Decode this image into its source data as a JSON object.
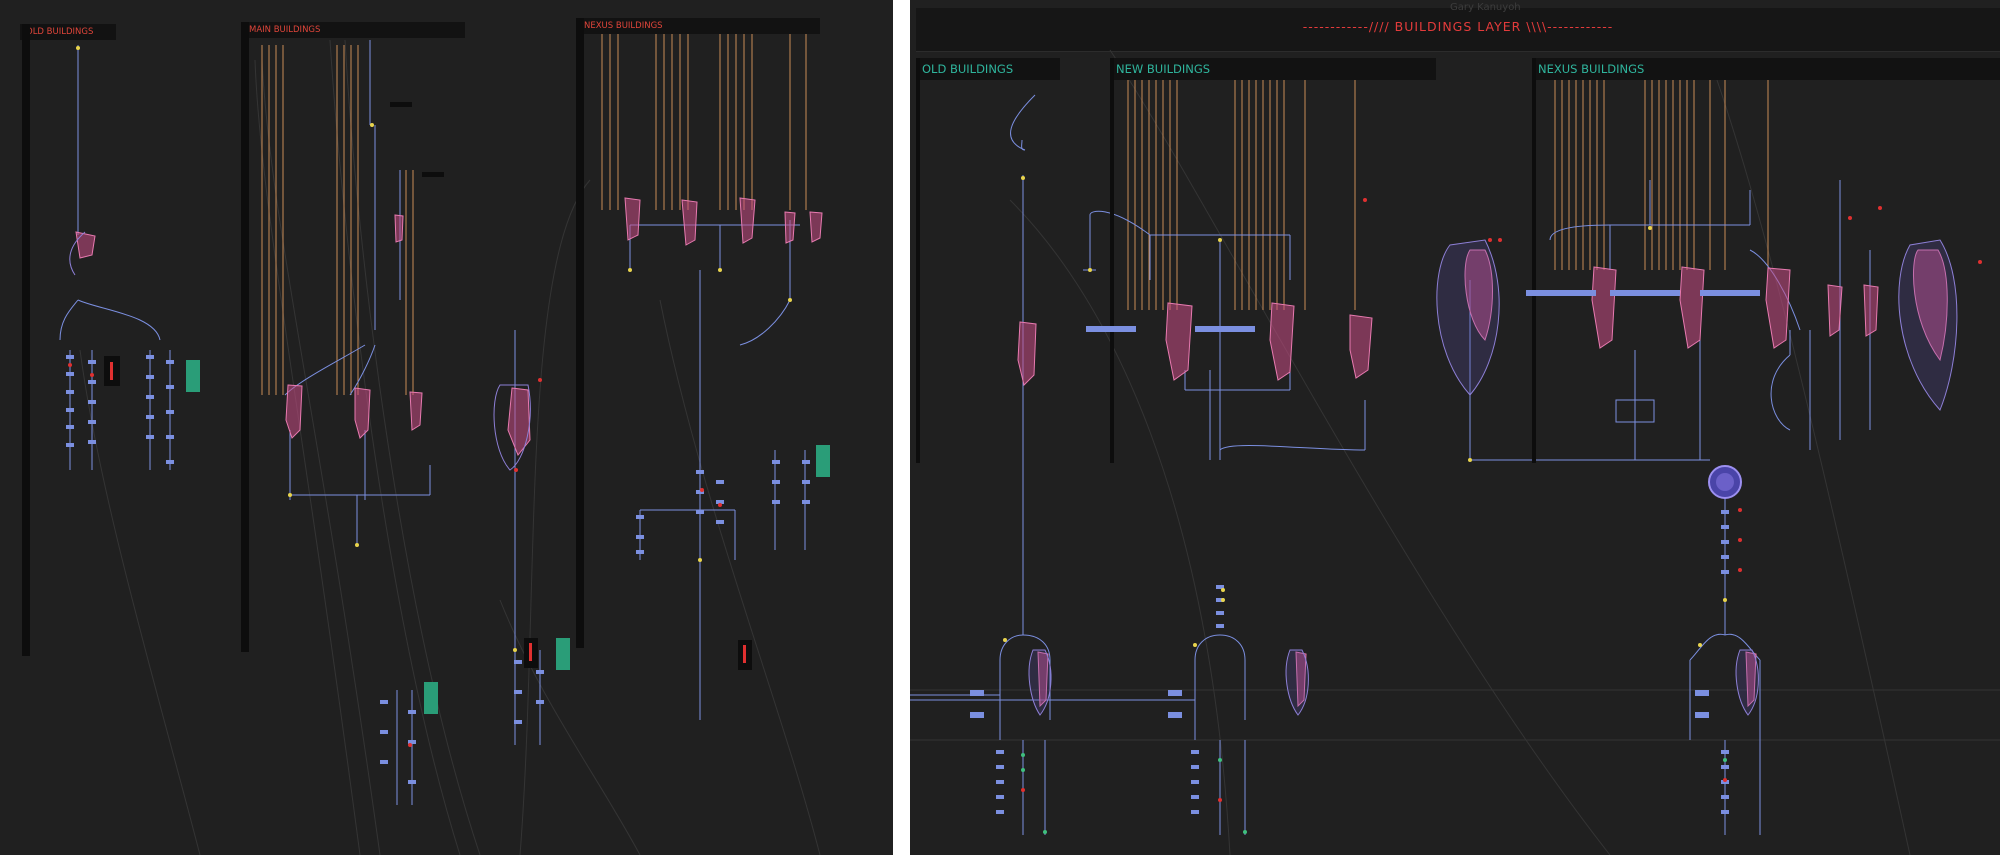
{
  "left_panel": {
    "backdrops": [
      {
        "id": "old",
        "title": "OLD BUILDINGS"
      },
      {
        "id": "main",
        "title": "MAIN BUILDINGS"
      },
      {
        "id": "nexus",
        "title": "NEXUS BUILDINGS"
      }
    ]
  },
  "right_panel": {
    "banner": "------------//// BUILDINGS LAYER \\\\\\\\------------",
    "faint_label": "Gary Kanuyoh",
    "backdrops": [
      {
        "id": "old",
        "title": "OLD BUILDINGS"
      },
      {
        "id": "new",
        "title": "NEW BUILDINGS"
      },
      {
        "id": "nexus",
        "title": "NEXUS BUILDINGS"
      }
    ]
  },
  "colors": {
    "canvas": "#202020",
    "divider": "#ffffff",
    "backdrop_header": "#121212",
    "header_red": "#e0453a",
    "header_teal": "#2fb59d",
    "pipe_orange": "#d9985a",
    "pipe_blue": "#7b8fe0",
    "pipe_grey": "#4a4a4a",
    "node_pink": "#d9508d",
    "node_purple": "#6b5fb8",
    "node_green": "#2a9d78",
    "accent_yellow": "#e8d44d",
    "accent_red": "#e03030"
  }
}
